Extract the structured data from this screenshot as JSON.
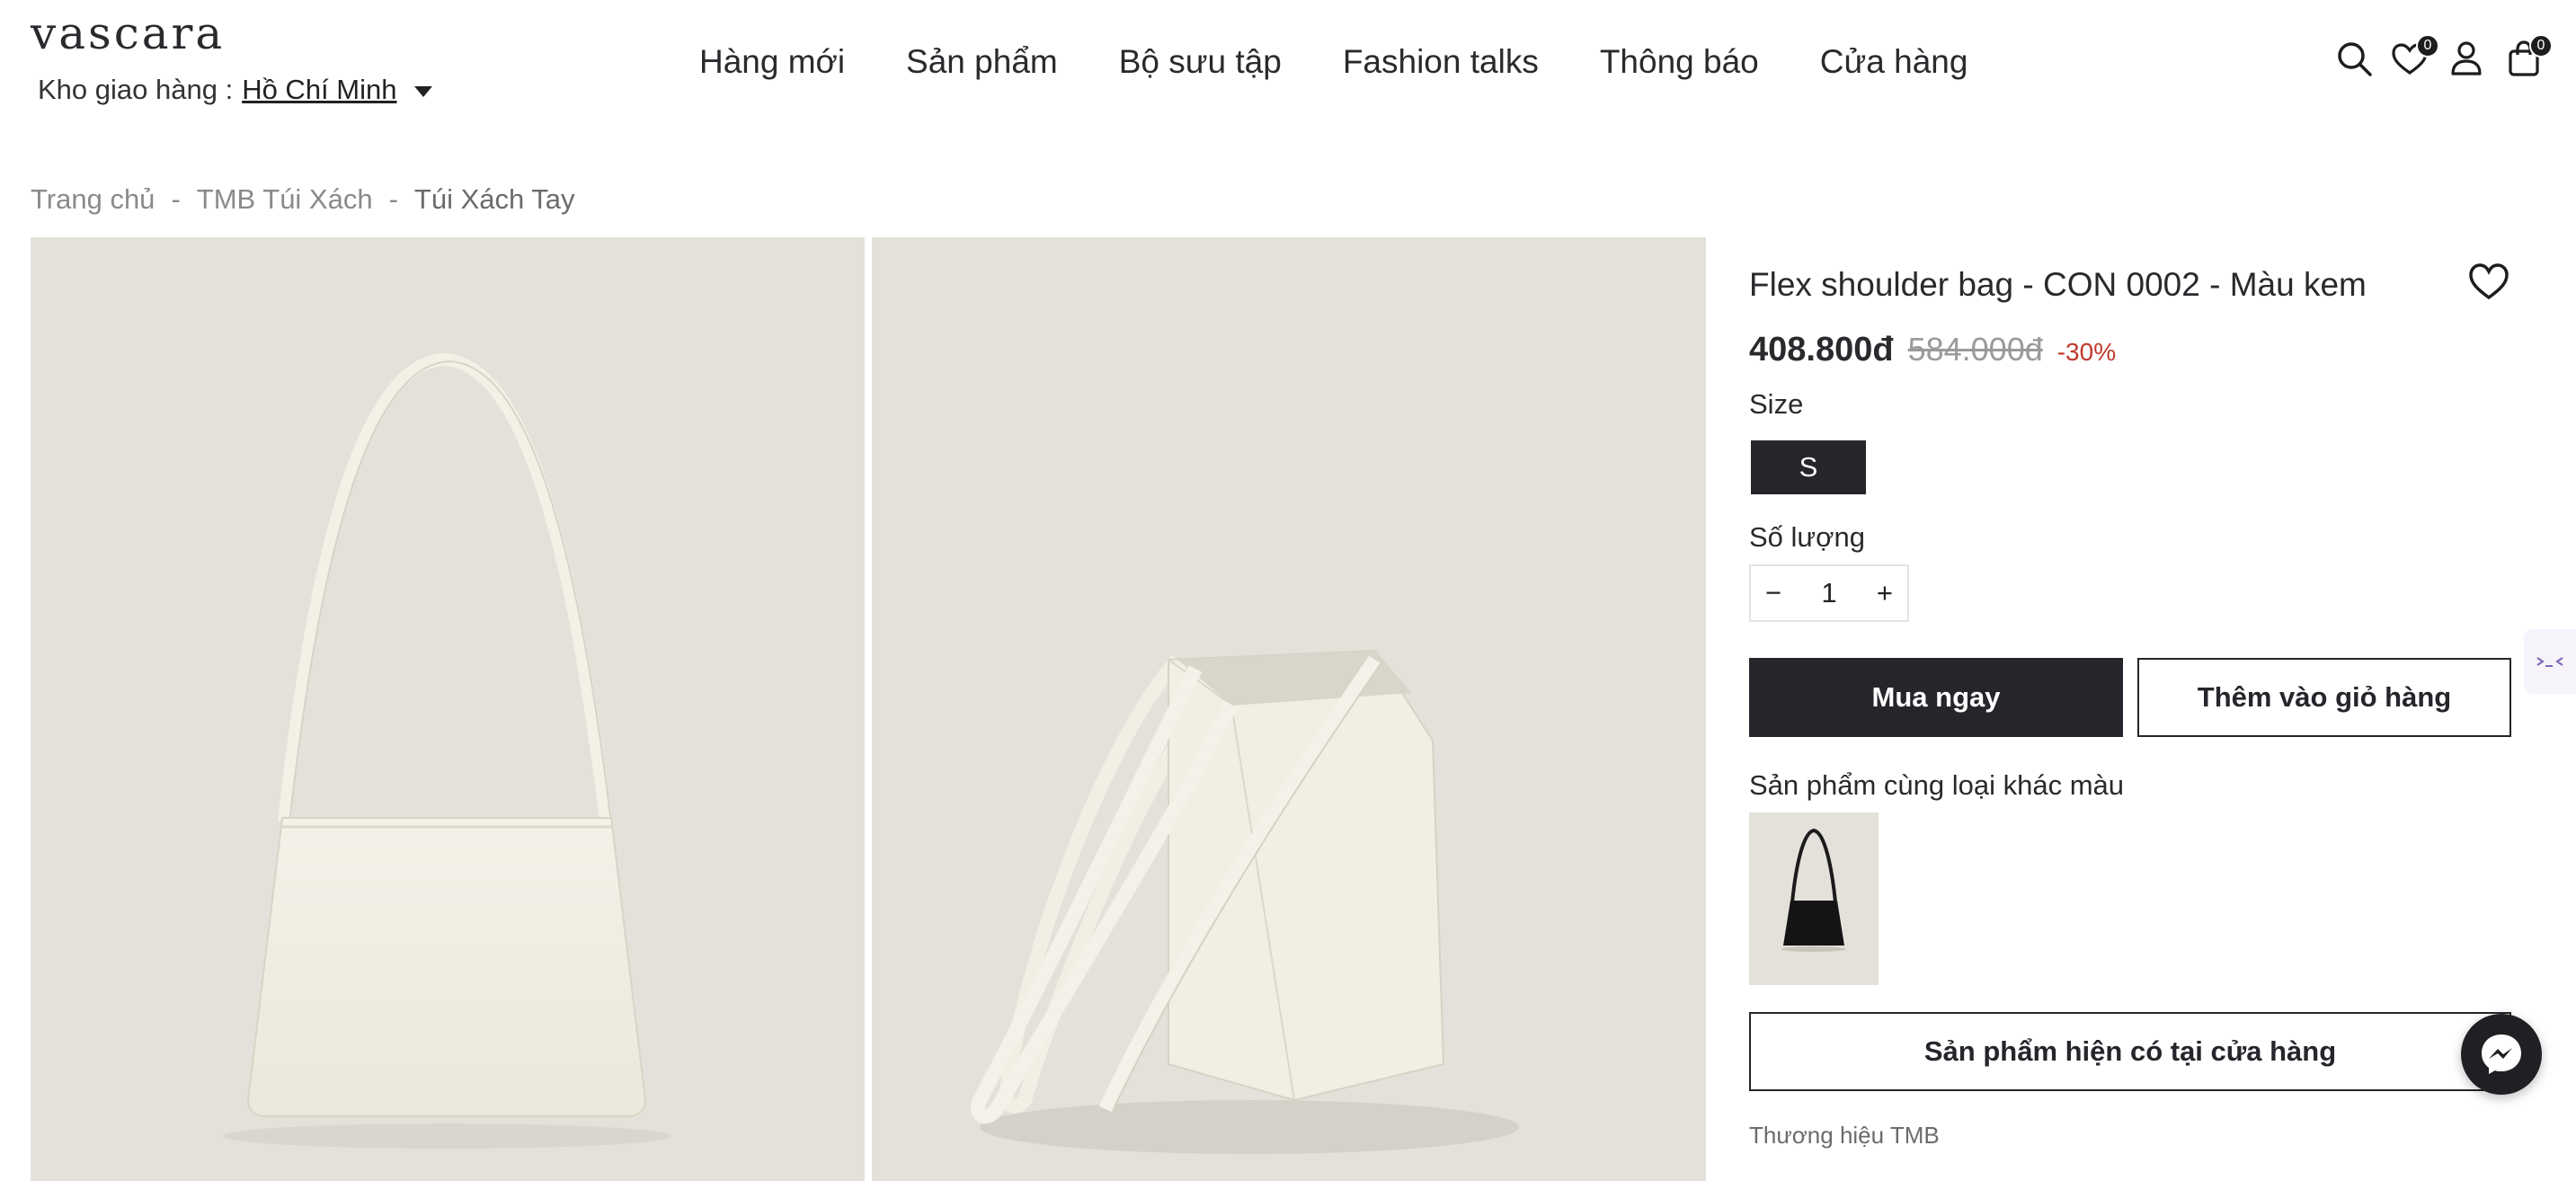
{
  "header": {
    "logo": "vascara",
    "warehouse_label": "Kho giao hàng :",
    "warehouse_city": "Hồ Chí Minh",
    "nav": [
      "Hàng mới",
      "Sản phẩm",
      "Bộ sưu tập",
      "Fashion talks",
      "Thông báo",
      "Cửa hàng"
    ],
    "wishlist_count": "0",
    "cart_count": "0"
  },
  "breadcrumb": {
    "items": [
      "Trang chủ",
      "TMB Túi Xách",
      "Túi Xách Tay"
    ],
    "separator": "-"
  },
  "product": {
    "title": "Flex shoulder bag - CON 0002 - Màu kem",
    "price": "408.800đ",
    "original_price": "584.000đ",
    "discount": "-30%",
    "size_label": "Size",
    "sizes": [
      "S"
    ],
    "quantity_label": "Số lượng",
    "quantity": "1",
    "buy_now_label": "Mua ngay",
    "add_to_cart_label": "Thêm vào giỏ hàng",
    "other_colors_label": "Sản phẩm cùng loại khác màu",
    "store_availability_label": "Sản phẩm hiện có tại cửa hàng",
    "brand_label": "Thương hiệu TMB"
  },
  "colors": {
    "primary_dark": "#25262b",
    "photo_bg": "#e4e1da",
    "discount_red": "#c0392b",
    "bag_cream": "#f3f0e6"
  },
  "icons": [
    "search-icon",
    "heart-icon",
    "user-icon",
    "bag-icon",
    "messenger-icon"
  ]
}
